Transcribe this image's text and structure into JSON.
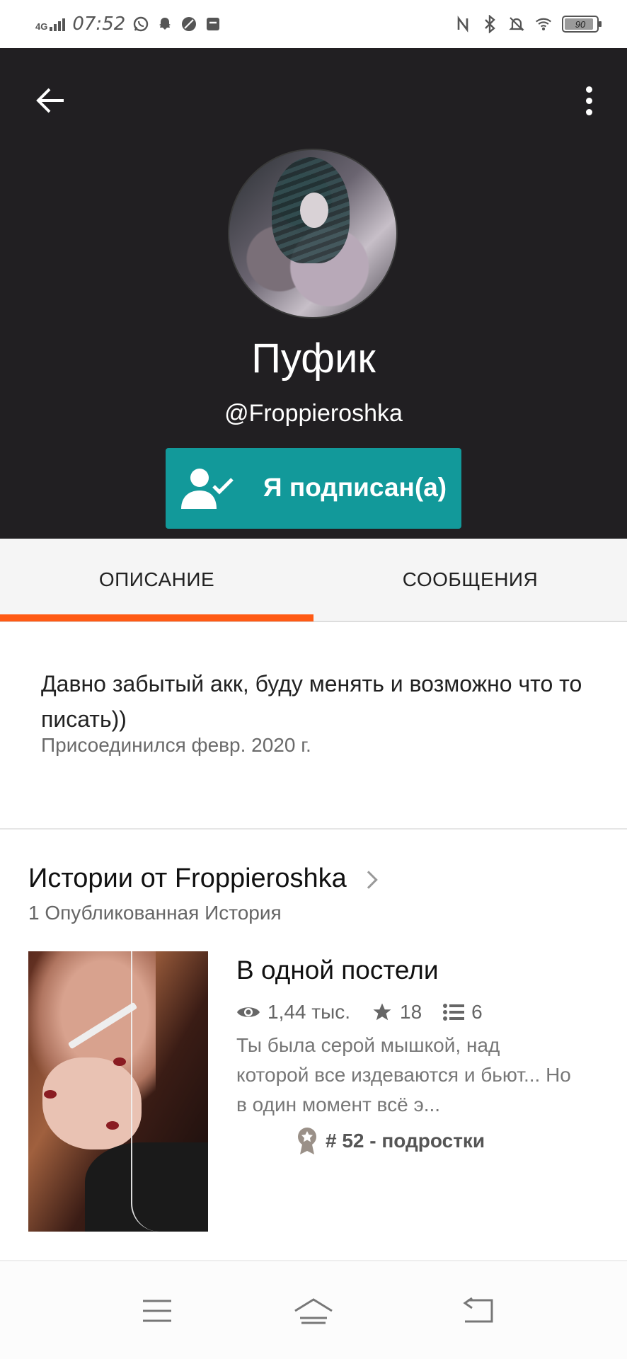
{
  "status_bar": {
    "network": "4G",
    "time": "07:52",
    "battery": "90",
    "battery_level_percent": 90
  },
  "header": {
    "display_name": "Пуфик",
    "username": "@Froppieroshka",
    "follow_button_label": "Я подписан(а)",
    "background_color": "#211f22",
    "follow_button_color": "#12999a"
  },
  "tabs": [
    {
      "label": "ОПИСАНИЕ",
      "active": true
    },
    {
      "label": "СООБЩЕНИЯ",
      "active": false
    }
  ],
  "accent_color": "#ff5a14",
  "about": {
    "text": "Давно забытый акк, буду менять и возможно что то писать))",
    "joined": "Присоединился февр. 2020 г."
  },
  "stories": {
    "title": "Истории от Froppieroshka",
    "count_label": "1 Опубликованная История",
    "items": [
      {
        "title": "В одной постели",
        "reads": "1,44 тыс.",
        "votes": "18",
        "parts": "6",
        "description": "Ты была серой мышкой, над которой все издеваются и бьют... Но в один момент всё э...",
        "rank": "# 52 - подростки"
      }
    ]
  },
  "nav": {
    "icons": [
      "menu-icon",
      "home-icon",
      "back-icon"
    ]
  }
}
